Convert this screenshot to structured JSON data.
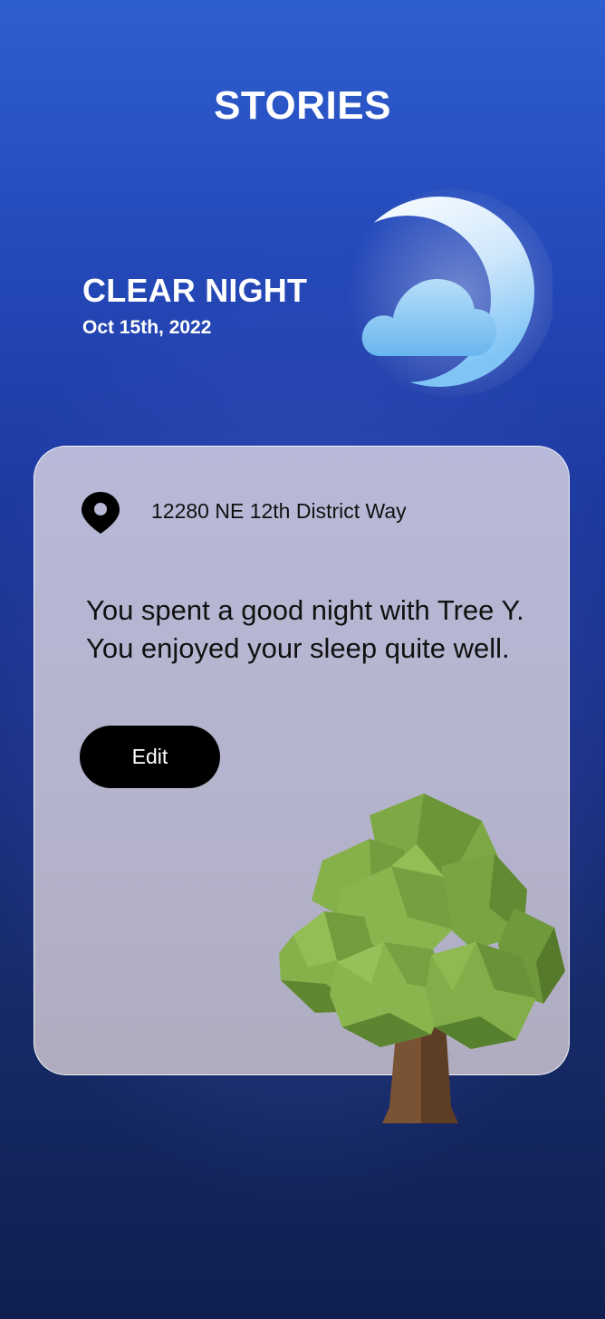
{
  "header": {
    "title": "STORIES"
  },
  "weather": {
    "condition": "CLEAR NIGHT",
    "date": "Oct 15th, 2022",
    "icon": "moon-cloud-icon"
  },
  "story_card": {
    "location_icon": "location-pin-icon",
    "address": "12280 NE 12th District Way",
    "story_lines": [
      "You spent a good night with Tree Y.",
      "You enjoyed your sleep quite well."
    ],
    "edit_label": "Edit",
    "illustration": "tree-icon"
  },
  "colors": {
    "background_top": "#2f5ecf",
    "background_bottom": "#0f1f4f",
    "card": "#b6b6d2",
    "button": "#000000",
    "tree_leaves": "#7aa23e",
    "tree_trunk": "#7a5234"
  }
}
